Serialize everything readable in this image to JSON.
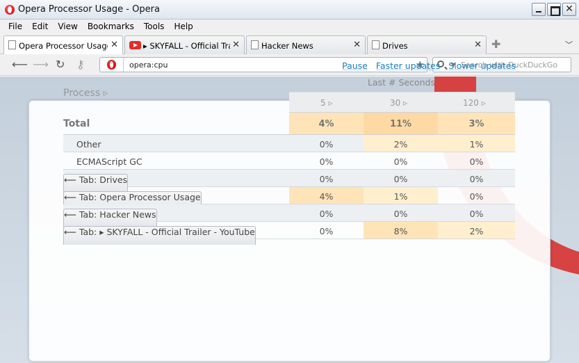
{
  "window": {
    "title": "Opera Processor Usage - Opera"
  },
  "menu": [
    "File",
    "Edit",
    "View",
    "Bookmarks",
    "Tools",
    "Help"
  ],
  "tabs": [
    {
      "label": "Opera Processor Usage",
      "icon": "page-icon",
      "active": true
    },
    {
      "label": "▸ SKYFALL - Official Trail...",
      "icon": "youtube-icon",
      "active": false
    },
    {
      "label": "Hacker News",
      "icon": "page-icon",
      "active": false
    },
    {
      "label": "Drives",
      "icon": "page-icon",
      "active": false
    }
  ],
  "address": {
    "url": "opera:cpu"
  },
  "search": {
    "placeholder": "Search with DuckDuckGo"
  },
  "page": {
    "actions": {
      "pause": "Pause",
      "faster": "Faster updates",
      "slower": "Slower updates"
    },
    "last_seconds": "Last # Seconds",
    "process_header": "Process ▹",
    "columns": [
      "5 ▹",
      "30 ▹",
      "120 ▹"
    ],
    "total": {
      "label": "Total",
      "v5": "4%",
      "v30": "11%",
      "v120": "3%"
    },
    "rows": [
      {
        "name": "Other",
        "v5": "0%",
        "v30": "2%",
        "v120": "1%"
      },
      {
        "name": "ECMAScript GC",
        "v5": "0%",
        "v30": "0%",
        "v120": "0%"
      },
      {
        "name": "⟵ Tab: Drives",
        "v5": "0%",
        "v30": "0%",
        "v120": "0%"
      },
      {
        "name": "⟵ Tab: Opera Processor Usage",
        "v5": "4%",
        "v30": "1%",
        "v120": "0%"
      },
      {
        "name": "⟵ Tab: Hacker News",
        "v5": "0%",
        "v30": "0%",
        "v120": "0%"
      },
      {
        "name": "⟵ Tab: ▸ SKYFALL - Official Trailer - YouTube",
        "v5": "0%",
        "v30": "8%",
        "v120": "2%"
      }
    ]
  }
}
